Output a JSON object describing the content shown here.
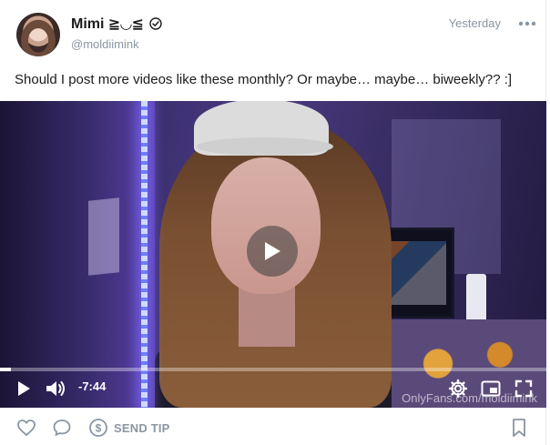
{
  "post": {
    "author_name": "Mimi ≧◡≦",
    "author_handle": "@moldiimink",
    "timestamp": "Yesterday",
    "caption": "Should I post more videos like these monthly? Or maybe… maybe… biweekly?? :]"
  },
  "video": {
    "time_remaining": "-7:44",
    "progress_fraction": 0.02,
    "watermark": "OnlyFans.com/moldiimink"
  },
  "footer": {
    "send_tip_label": "SEND TIP"
  },
  "icons": {
    "verified": "verified-badge-icon",
    "more": "more-options-icon",
    "play": "play-icon",
    "volume": "volume-icon",
    "settings": "gear-icon",
    "pip": "picture-in-picture-icon",
    "fullscreen": "fullscreen-icon",
    "like": "heart-icon",
    "comment": "comment-icon",
    "tip": "dollar-icon",
    "bookmark": "bookmark-icon"
  },
  "colors": {
    "muted_text": "#8a96a3",
    "text": "#1b1b1b"
  }
}
